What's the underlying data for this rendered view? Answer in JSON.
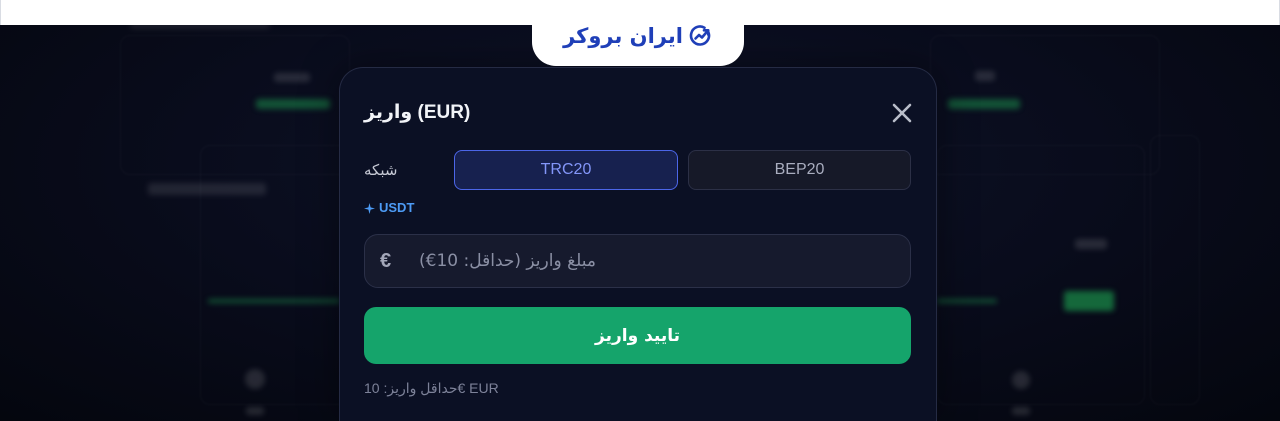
{
  "header": {
    "logo_text": "ایران بروکر",
    "logo_icon": "trend-up-circle-icon"
  },
  "modal": {
    "title": "واریز (EUR)",
    "close_icon": "close-icon",
    "network": {
      "label": "شبکه",
      "options": [
        {
          "label": "TRC20",
          "selected": true
        },
        {
          "label": "BEP20",
          "selected": false
        }
      ]
    },
    "token": {
      "icon": "sparkle-icon",
      "label": "USDT"
    },
    "amount": {
      "currency_symbol": "€",
      "placeholder": "مبلغ واریز (حداقل: 10€)"
    },
    "submit_label": "تایید واریز",
    "footer_note": "حداقل واریز: 10€ EUR"
  },
  "colors": {
    "accent": "#15a46b",
    "selected": "#4c66e8",
    "selected_text": "#8396f8",
    "token": "#4d9bf5",
    "brand": "#1f3fb8",
    "modal_bg": "#0b1024"
  }
}
